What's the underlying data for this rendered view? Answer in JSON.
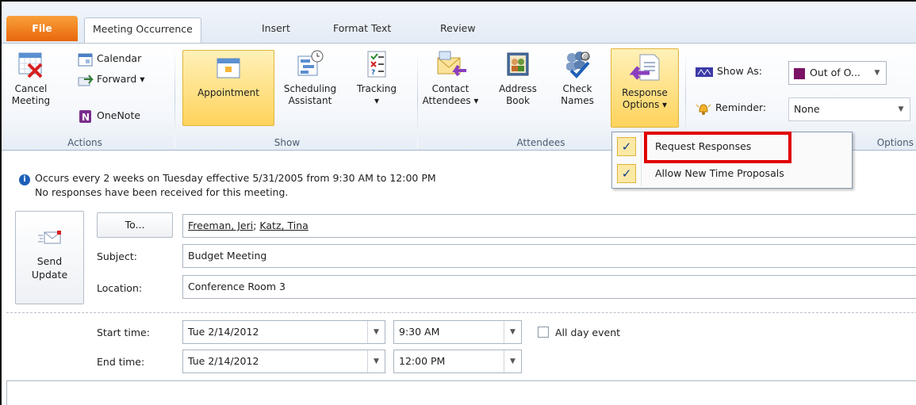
{
  "tabs": {
    "file": "File",
    "meeting_occurrence": "Meeting Occurrence",
    "insert": "Insert",
    "format_text": "Format Text",
    "review": "Review"
  },
  "ribbon": {
    "actions": {
      "cancel_line1": "Cancel",
      "cancel_line2": "Meeting",
      "calendar": "Calendar",
      "forward": "Forward ▾",
      "onenote": "OneNote",
      "label": "Actions"
    },
    "show": {
      "appointment": "Appointment",
      "scheduling_line1": "Scheduling",
      "scheduling_line2": "Assistant",
      "tracking": "Tracking",
      "tracking_arrow": "▾",
      "label": "Show"
    },
    "attendees": {
      "contact_line1": "Contact",
      "contact_line2": "Attendees ▾",
      "address_line1": "Address",
      "address_line2": "Book",
      "check_line1": "Check",
      "check_line2": "Names",
      "response_line1": "Response",
      "response_line2": "Options ▾",
      "label": "Attendees"
    },
    "options": {
      "show_as_label": "Show As:",
      "show_as_value": "Out of O...",
      "reminder_label": "Reminder:",
      "reminder_value": "None",
      "label": "Options"
    }
  },
  "dropdown": {
    "items": [
      {
        "label": "Request Responses",
        "checked": true
      },
      {
        "label": "Allow New Time Proposals",
        "checked": true
      }
    ]
  },
  "info": {
    "line1": "Occurs every 2 weeks on Tuesday effective 5/31/2005 from 9:30 AM to 12:00 PM",
    "line2": "No responses have been received for this meeting."
  },
  "form": {
    "send_line1": "Send",
    "send_line2": "Update",
    "to_button": "To...",
    "to_recipient1": "Freeman, Jeri",
    "to_separator": "; ",
    "to_recipient2": "Katz, Tina",
    "subject_label": "Subject:",
    "subject_value": "Budget Meeting",
    "location_label": "Location:",
    "location_value": "Conference Room 3",
    "start_label": "Start time:",
    "start_date": "Tue 2/14/2012",
    "start_time": "9:30 AM",
    "all_day_label": "All day event",
    "end_label": "End time:",
    "end_date": "Tue 2/14/2012",
    "end_time": "12:00 PM"
  },
  "colors": {
    "file_tab": "#e8660c",
    "highlight": "#ffd35c",
    "red_box": "#e00000",
    "out_of_office": "#7b1265"
  }
}
